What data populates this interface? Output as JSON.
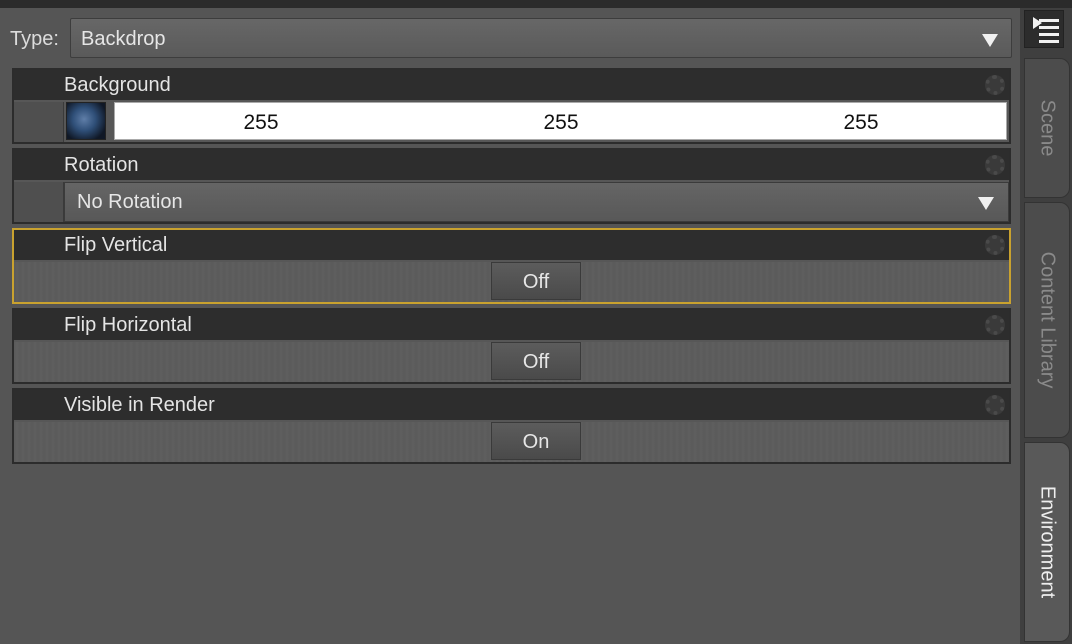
{
  "type_row": {
    "label": "Type:",
    "value": "Backdrop",
    "arrow_icon": "triangle-down"
  },
  "panels": {
    "background": {
      "title": "Background",
      "red": "255",
      "green": "255",
      "blue": "255"
    },
    "rotation": {
      "title": "Rotation",
      "value": "No Rotation"
    },
    "flip_vertical": {
      "title": "Flip Vertical",
      "value": "Off"
    },
    "flip_horizontal": {
      "title": "Flip Horizontal",
      "value": "Off"
    },
    "visible_in_render": {
      "title": "Visible in Render",
      "value": "On"
    }
  },
  "side_tabs": {
    "scene": "Scene",
    "content_library": "Content Library",
    "environment": "Environment"
  },
  "colors": {
    "selected_outline": "#c9a22f",
    "header_bg": "#2d2d2d",
    "panel_bg": "#555555"
  },
  "icons": {
    "panel_options": "gear-icon",
    "side_menu": "panel-menu-icon"
  }
}
